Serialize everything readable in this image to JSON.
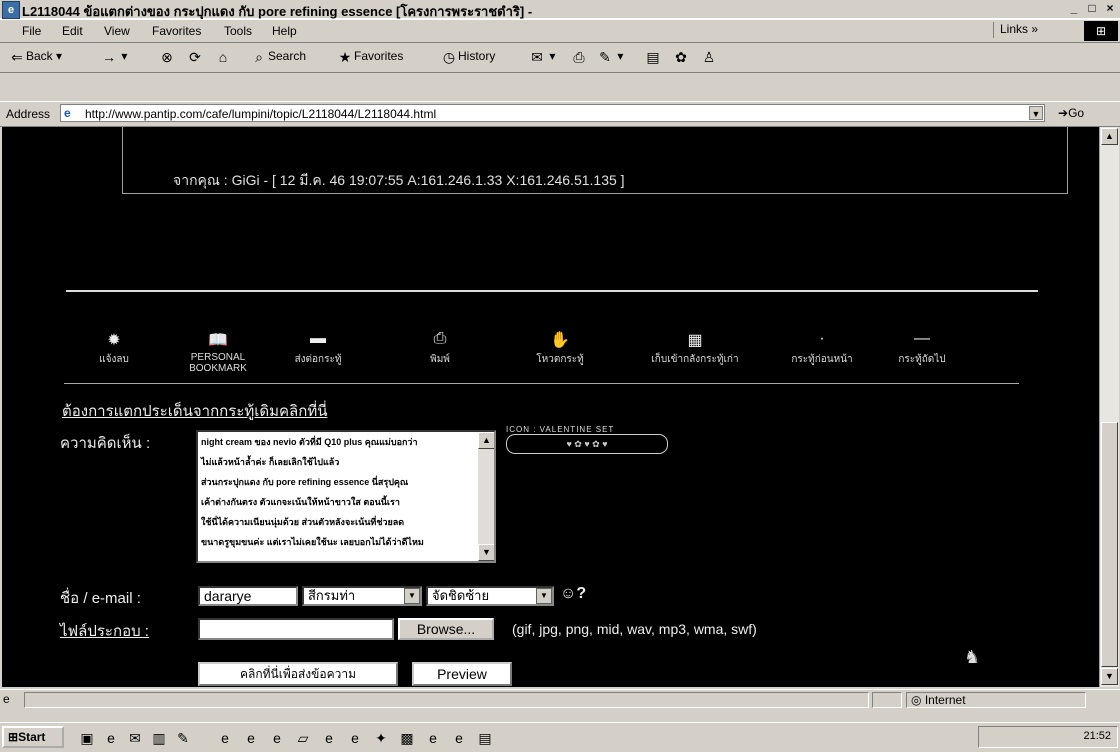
{
  "window": {
    "title": "L2118044 ข้อแตกต่างของ กระปุกแดง กับ pore refining essence [โครงการพระราชดำริ] -",
    "buttons": [
      "_",
      "□",
      "×"
    ]
  },
  "menu": {
    "items": [
      "File",
      "Edit",
      "View",
      "Favorites",
      "Tools",
      "Help"
    ],
    "links_label": "Links"
  },
  "toolbar": {
    "back": "Back",
    "search": "Search",
    "favorites": "Favorites",
    "history": "History"
  },
  "address": {
    "label": "Address",
    "url": "http://www.pantip.com/cafe/lumpini/topic/L2118044/L2118044.html",
    "go": "Go"
  },
  "post": {
    "meta": "จากคุณ : GiGi - [ 12 มี.ค. 46 19:07:55 A:161.246.1.33 X:161.246.51.135 ]"
  },
  "nav_items": [
    {
      "label": "แจ้งลบ",
      "icon": "bomb-icon"
    },
    {
      "label": "PERSONAL BOOKMARK",
      "icon": "book-icon"
    },
    {
      "label": "ส่งต่อกระทู้",
      "icon": "forward-icon"
    },
    {
      "label": "พิมพ์",
      "icon": "printer-icon"
    },
    {
      "label": "โหวตกระทู้",
      "icon": "hand-icon"
    },
    {
      "label": "เก็บเข้ากลังกระทู้เก่า",
      "icon": "archive-icon"
    },
    {
      "label": "กระทู้ก่อนหน้า",
      "icon": "prev-icon"
    },
    {
      "label": "กระทู้ถัดไป",
      "icon": "next-icon"
    }
  ],
  "form": {
    "branch_link": "ต้องการแตกประเด็นจากกระทู้เดิมคลิกที่นี่",
    "opinion_label": "ความคิดเห็น :",
    "opinion_lines": [
      "night cream ของ nevio ตัวที่มี Q10 plus คุณแม่บอกว่า",
      "ไม่แล้วหน้าล้ำค่ะ ก็เลยเลิกใช้ไปแล้ว",
      "ส่วนกระปุกแดง กับ pore refining essence นี่สรุปคุณ",
      "เค้าต่างกันตรง ตัวแกจะเน้นให้หน้าขาวใส ตอนนี้เรา",
      "ใช้นี่ได้ความเนียนนุ่มด้วย ส่วนตัวหลังจะเน้นที่ช่วยลด",
      "ขนาดรูขุมขนค่ะ แต่เราไม่เคยใช้นะ เลยบอกไม่ได้ว่าดีไหม"
    ],
    "icon_label": "ICON : VALENTINE SET",
    "name_label": "ชื่อ / e-mail :",
    "name_value": "dararye",
    "select1_value": "สีกรมท่า",
    "select2_value": "จัดชิดซ้าย",
    "smiley": "☺?",
    "attach_label": "ไฟล์ประกอบ :",
    "browse_label": "Browse...",
    "file_types": "(gif, jpg, png, mid, wav, mp3, wma, swf)",
    "submit_label": "คลิกที่นี่เพื่อส่งข้อความ",
    "preview_label": "Preview"
  },
  "status": {
    "zone": "Internet"
  },
  "taskbar": {
    "start": "Start",
    "clock": "21:52"
  }
}
